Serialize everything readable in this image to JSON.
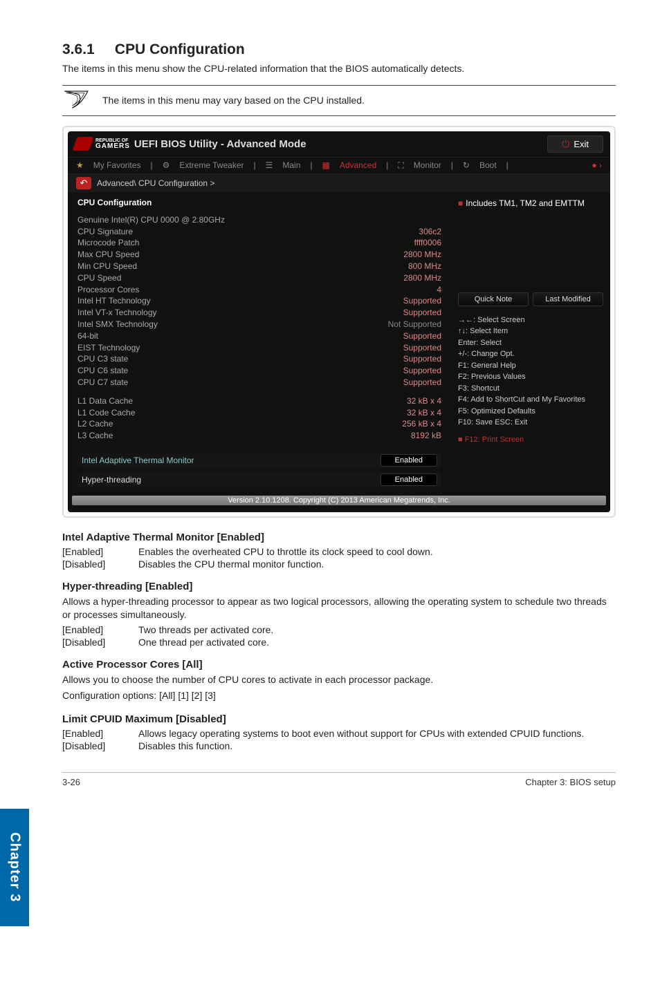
{
  "chapter_tab": "Chapter 3",
  "section": {
    "number": "3.6.1",
    "title": "CPU Configuration",
    "intro": "The items in this menu show the CPU-related information that the BIOS automatically detects.",
    "note": "The items in this menu may vary based on the CPU installed."
  },
  "bios": {
    "brand_top": "REPUBLIC OF",
    "brand_bottom": "GAMERS",
    "title": "UEFI BIOS Utility - Advanced Mode",
    "exit": "Exit",
    "menubar": {
      "fav": "My Favorites",
      "extreme": "Extreme Tweaker",
      "main": "Main",
      "advanced": "Advanced",
      "monitor": "Monitor",
      "boot": "Boot"
    },
    "breadcrumb": "Advanced\\ CPU Configuration >",
    "left_header": "CPU Configuration",
    "help_text": "Includes TM1, TM2 and EMTTM",
    "rows": {
      "genuine": {
        "k": "Genuine Intel(R) CPU 0000 @ 2.80GHz",
        "v": ""
      },
      "sig": {
        "k": "CPU Signature",
        "v": "306c2"
      },
      "micro": {
        "k": "Microcode Patch",
        "v": "ffff0006"
      },
      "max": {
        "k": "Max CPU Speed",
        "v": "2800 MHz"
      },
      "min": {
        "k": "Min CPU Speed",
        "v": "800 MHz"
      },
      "spd": {
        "k": "CPU Speed",
        "v": "2800 MHz"
      },
      "cores": {
        "k": "Processor Cores",
        "v": "4"
      },
      "ht": {
        "k": "Intel HT Technology",
        "v": "Supported"
      },
      "vtx": {
        "k": "Intel VT-x Technology",
        "v": "Supported"
      },
      "smx": {
        "k": "Intel SMX Technology",
        "v": "Not Supported"
      },
      "b64": {
        "k": "64-bit",
        "v": "Supported"
      },
      "eist": {
        "k": "EIST Technology",
        "v": "Supported"
      },
      "c3": {
        "k": "CPU C3 state",
        "v": "Supported"
      },
      "c6": {
        "k": "CPU C6 state",
        "v": "Supported"
      },
      "c7": {
        "k": "CPU C7 state",
        "v": "Supported"
      },
      "l1d": {
        "k": "L1 Data Cache",
        "v": "32 kB x 4"
      },
      "l1c": {
        "k": "L1 Code Cache",
        "v": "32 kB x 4"
      },
      "l2": {
        "k": "L2 Cache",
        "v": "256 kB x 4"
      },
      "l3": {
        "k": "L3 Cache",
        "v": "8192 kB"
      }
    },
    "opt_thermal": {
      "k": "Intel Adaptive Thermal Monitor",
      "v": "Enabled"
    },
    "opt_hyper": {
      "k": "Hyper-threading",
      "v": "Enabled"
    },
    "quick_note": "Quick Note",
    "last_mod": "Last Modified",
    "hotkeys": {
      "arrows": "→←: Select Screen",
      "updown": "↑↓: Select Item",
      "enter": "Enter: Select",
      "pm": "+/-: Change Opt.",
      "f1": "F1: General Help",
      "f2": "F2: Previous Values",
      "f3": "F3: Shortcut",
      "f4": "F4: Add to ShortCut and My Favorites",
      "f5": "F5: Optimized Defaults",
      "f10": "F10: Save  ESC: Exit",
      "f12": "F12: Print Screen"
    },
    "version": "Version 2.10.1208. Copyright (C) 2013 American Megatrends, Inc."
  },
  "doc": {
    "h_thermal": "Intel Adaptive Thermal Monitor [Enabled]",
    "thermal_enabled": {
      "k": "[Enabled]",
      "v": "Enables the overheated CPU to throttle its clock speed to cool down."
    },
    "thermal_disabled": {
      "k": "[Disabled]",
      "v": "Disables the CPU thermal monitor function."
    },
    "h_hyper": "Hyper-threading [Enabled]",
    "hyper_para": "Allows a hyper-threading processor to appear as two logical processors, allowing the operating system to schedule two threads or processes simultaneously.",
    "hyper_enabled": {
      "k": "[Enabled]",
      "v": "Two threads per activated core."
    },
    "hyper_disabled": {
      "k": "[Disabled]",
      "v": "One thread per activated core."
    },
    "h_cores": "Active Processor Cores [All]",
    "cores_para": "Allows you to choose the number of CPU cores to activate in each processor package.",
    "cores_opts": "Configuration options: [All] [1] [2] [3]",
    "h_cpuid": "Limit CPUID Maximum [Disabled]",
    "cpuid_enabled": {
      "k": "[Enabled]",
      "v": "Allows legacy operating systems to boot even without support for CPUs with extended CPUID functions."
    },
    "cpuid_disabled": {
      "k": "[Disabled]",
      "v": "Disables this function."
    }
  },
  "footer": {
    "left": "3-26",
    "right": "Chapter 3: BIOS setup"
  }
}
